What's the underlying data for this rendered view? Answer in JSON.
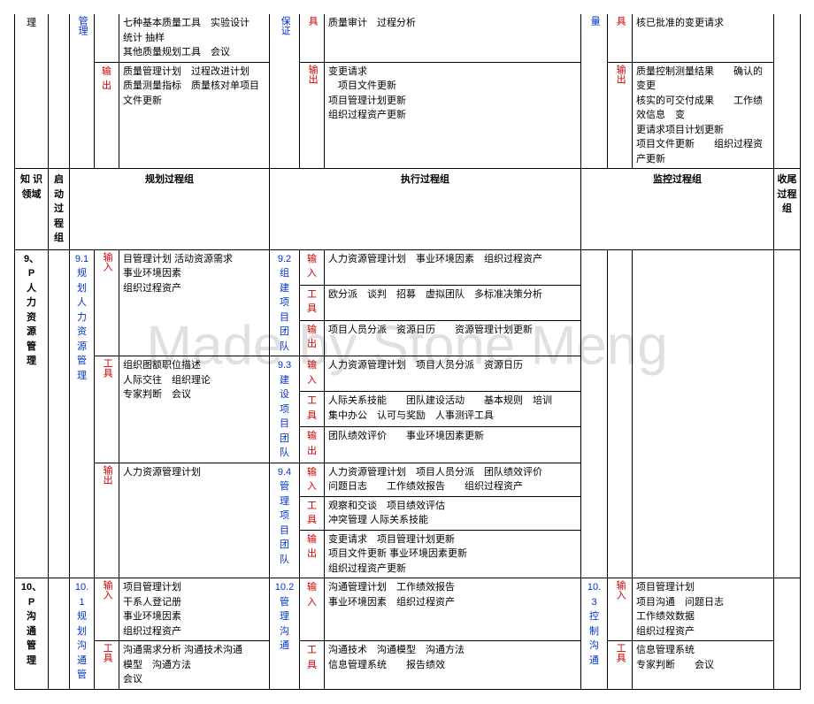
{
  "watermark": "Made by Stone Meng",
  "top": {
    "domain": "理",
    "proc": "管理",
    "tool_label": "",
    "row1_col3": "七种基本质量工具　实验设计　统计 抽样\n其他质量规划工具　会议",
    "qa_col1": "保证",
    "qa_col2": "具",
    "qa_text": "质量审计　过程分析",
    "qc_col1": "量",
    "qc_col2": "具",
    "qc_text": "核已批准的变更请求",
    "out_label": "输出",
    "out_left": "质量管理计划　过程改进计划\n质量测量指标　质量核对单项目文件更新",
    "mid_label": "输出",
    "out_mid": "变更请求\n　项目文件更新\n项目管理计划更新\n组织过程资产更新",
    "right_label": "输出",
    "out_right": "质量控制测量结果　　确认的变更\n核实的可交付成果　　工作绩效信息　变\n更请求项目计划更新\n项目文件更新　　组织过程资产更新"
  },
  "hdr": {
    "c1": "知 识\n领域",
    "c2": "启动\n过程组",
    "c3": "规划过程组",
    "c4": "执行过程组",
    "c5": "监控过程组",
    "c6": "收尾\n过程组"
  },
  "hr": {
    "domain": "9、\nP\n人\n力\n资\n源\n管\n理",
    "proc": "9.1\n规\n划\n人\n力\n资\n源\n管\n理",
    "in_label": "输入",
    "in_text": "目管理计划 活动资源需求\n事业环境因素\n组织过程资产",
    "tool_label": "工具",
    "tool_text": "组织图额职位描述\n人际交往　组织理论\n专家判断　会议",
    "out_label": "输出",
    "out_text": "人力资源管理计划",
    "e1": {
      "proc": "9.2\n组\n建\n项\n目\n团\n队",
      "in": "输入",
      "in_t": "人力资源管理计划　事业环境因素　组织过程资产",
      "tl": "工具",
      "tl_t": "欧分派　谈判　招募　虚拟团队　多标准决策分析",
      "ou": "输出",
      "ou_t": "项目人员分派　资源日历　　资源管理计划更新"
    },
    "e2": {
      "proc": "9.3\n建\n设\n项\n目\n团\n队",
      "in": "输入",
      "in_t": "人力资源管理计划　项目人员分派　资源日历",
      "tl": "工具",
      "tl_t": "人际关系技能　　团队建设活动　　基本规则　培训\n集中办公　认可与奖励　人事测评工具",
      "ou": "输出",
      "ou_t": "团队绩效评价　　事业环境因素更新"
    },
    "e3": {
      "proc": "9.4\n管\n理\n项\n目\n团\n队",
      "in": "输入",
      "in_t": "人力资源管理计划　项目人员分派　团队绩效评价\n问题日志　　工作绩效报告　　组织过程资产",
      "tl": "工具",
      "tl_t": "观察和交谈　项目绩效评估\n冲突管理 人际关系技能",
      "ou": "输出",
      "ou_t": "变更请求　项目管理计划更新\n项目文件更新 事业环境因素更新\n组织过程资产更新"
    }
  },
  "comm": {
    "domain": "10、\nP\n沟\n通\n管\n理",
    "proc": "10.\n1\n规\n划\n沟\n通\n管",
    "in_label": "输入",
    "in_text": "项目管理计划\n干系人登记册\n事业环境因素\n组织过程资产",
    "tool_label": "工具",
    "tool_text": "沟通需求分析 沟通技术沟通\n模型　沟通方法\n会议",
    "exec_proc": "10.2\n管\n理\n沟\n通",
    "exec_in": "输入",
    "exec_in_t": "沟通管理计划　工作绩效报告\n事业环境因素　组织过程资产",
    "exec_tl": "工具",
    "exec_tl_t": "沟通技术　沟通模型　沟通方法\n信息管理系统　　报告绩效",
    "mon_proc": "10.3\n控\n制\n沟\n通",
    "mon_in": "输入",
    "mon_in_t": "项目管理计划\n项目沟通　问题日志\n工作绩效数据\n组织过程资产",
    "mon_tl": "工具",
    "mon_tl_t": "信息管理系统\n专家判断　　会议"
  }
}
